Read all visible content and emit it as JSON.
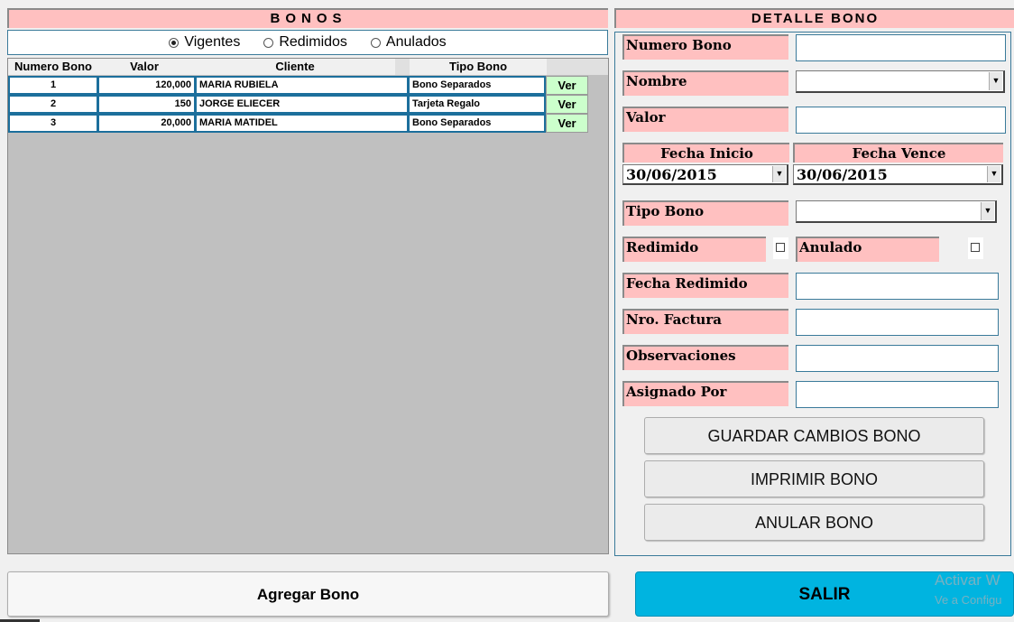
{
  "bonos": {
    "title": "BONOS",
    "filters": [
      {
        "label": "Vigentes",
        "checked": true
      },
      {
        "label": "Redimidos",
        "checked": false
      },
      {
        "label": "Anulados",
        "checked": false
      }
    ],
    "columns": [
      "Numero Bono",
      "Valor",
      "Cliente",
      "Tipo Bono"
    ],
    "rows": [
      {
        "numero": "1",
        "valor": "120,000",
        "cliente": "MARIA RUBIELA",
        "tipo": "Bono Separados",
        "ver": "Ver"
      },
      {
        "numero": "2",
        "valor": "150",
        "cliente": "JORGE ELIECER",
        "tipo": "Tarjeta Regalo",
        "ver": "Ver"
      },
      {
        "numero": "3",
        "valor": "20,000",
        "cliente": "MARIA MATIDEL",
        "tipo": "Bono Separados",
        "ver": "Ver"
      }
    ]
  },
  "detalle": {
    "title": "DETALLE BONO",
    "numero_bono_label": "Numero Bono",
    "numero_bono_value": "",
    "nombre_label": "Nombre",
    "nombre_value": "",
    "valor_label": "Valor",
    "valor_value": "",
    "fecha_inicio_label": "Fecha Inicio",
    "fecha_inicio_value": "30/06/2015",
    "fecha_vence_label": "Fecha Vence",
    "fecha_vence_value": "30/06/2015",
    "tipo_bono_label": "Tipo Bono",
    "tipo_bono_value": "",
    "redimido_label": "Redimido",
    "redimido_checked": false,
    "anulado_label": "Anulado",
    "anulado_checked": false,
    "fecha_redimido_label": "Fecha Redimido",
    "nro_factura_label": "Nro. Factura",
    "observaciones_label": "Observaciones",
    "asignado_por_label": "Asignado Por",
    "guardar_label": "GUARDAR CAMBIOS BONO",
    "imprimir_label": "IMPRIMIR BONO",
    "anular_label": "ANULAR BONO"
  },
  "footer": {
    "agregar_label": "Agregar Bono",
    "salir_label": "SALIR"
  },
  "watermark": {
    "line1": "Activar W",
    "line2": "Ve a Configu"
  },
  "colors": {
    "label_bg": "#ffc0c0",
    "salir_bg": "#00b4e0",
    "ver_bg": "#ccffcc",
    "grid_bg": "#c0c0c0"
  }
}
